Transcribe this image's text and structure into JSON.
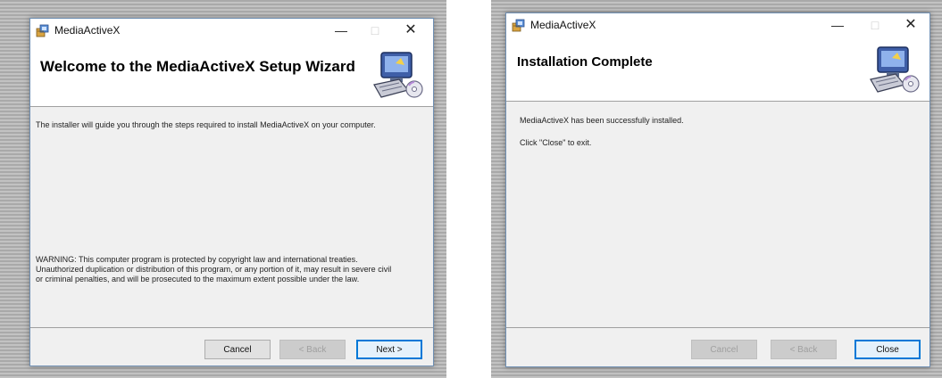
{
  "left_window": {
    "title": "MediaActiveX",
    "controls": {
      "minimize": "—",
      "maximize": "□",
      "close": "✕"
    },
    "heading": "Welcome to the MediaActiveX Setup Wizard",
    "intro": "The installer will guide you through the steps required to install MediaActiveX on your computer.",
    "warning_line1": "WARNING: This computer program is protected by copyright law and international treaties.",
    "warning_line2": "Unauthorized duplication or distribution of this program, or any portion of it, may result in severe civil",
    "warning_line3": "or criminal penalties, and will be prosecuted to the maximum extent possible under the law.",
    "buttons": {
      "cancel": "Cancel",
      "back": "< Back",
      "next": "Next >"
    }
  },
  "right_window": {
    "title": "MediaActiveX",
    "controls": {
      "minimize": "—",
      "maximize": "□",
      "close": "✕"
    },
    "heading": "Installation Complete",
    "message": "MediaActiveX has been successfully installed.",
    "instruction": "Click \"Close\" to exit.",
    "buttons": {
      "cancel": "Cancel",
      "back": "< Back",
      "close": "Close"
    }
  },
  "icons": {
    "app": "installer-package-icon",
    "banner": "computer-setup-icon"
  }
}
